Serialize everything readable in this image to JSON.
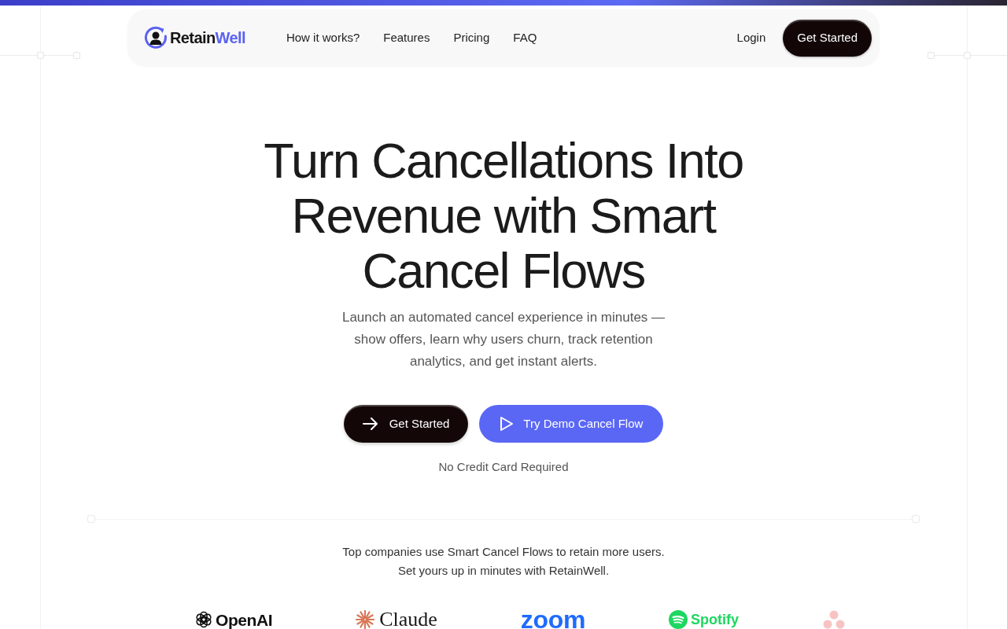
{
  "nav": {
    "brand": {
      "primary": "Retain",
      "accent": "Well"
    },
    "links": [
      {
        "label": "How it works?"
      },
      {
        "label": "Features"
      },
      {
        "label": "Pricing"
      },
      {
        "label": "FAQ"
      }
    ],
    "login": "Login",
    "cta": "Get Started"
  },
  "hero": {
    "title": "Turn Cancellations Into Revenue with Smart Cancel Flows",
    "subtitle": "Launch an automated cancel experience in minutes — show offers, learn why users churn, track retention analytics, and get instant alerts.",
    "buttons": [
      {
        "kind": "primary",
        "label": "Get Started"
      },
      {
        "kind": "demo",
        "label": "Try Demo Cancel Flow"
      }
    ],
    "note": "No Credit Card Required"
  },
  "social_proof": {
    "lines": [
      "Top companies use Smart Cancel Flows to retain more users.",
      "Set yours up in minutes with RetainWell."
    ],
    "logos": [
      {
        "kind": "openai",
        "name": "OpenAI"
      },
      {
        "kind": "claude",
        "name": "Claude"
      },
      {
        "kind": "zoom",
        "name": "zoom"
      },
      {
        "kind": "spotify",
        "name": "Spotify"
      },
      {
        "kind": "asana"
      }
    ]
  }
}
